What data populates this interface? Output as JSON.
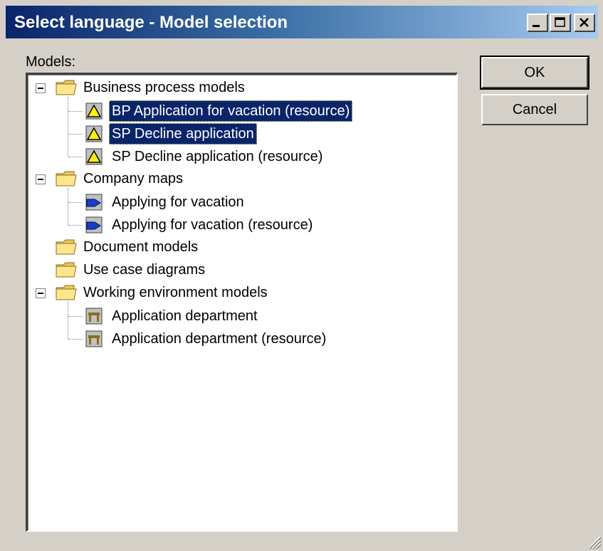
{
  "window": {
    "title": "Select language - Model selection"
  },
  "titlebar_buttons": [
    "minimize-icon",
    "maximize-icon",
    "close-icon"
  ],
  "models_label": "Models:",
  "buttons": {
    "ok": "OK",
    "cancel": "Cancel"
  },
  "tree": {
    "groups": [
      {
        "label": "Business process models",
        "expanded": true,
        "items": [
          {
            "label": "BP Application for vacation (resource)",
            "icon": "process-model-icon",
            "selected": true
          },
          {
            "label": "SP Decline application",
            "icon": "process-model-icon",
            "selected": true
          },
          {
            "label": "SP Decline application (resource)",
            "icon": "process-model-icon",
            "selected": false
          }
        ]
      },
      {
        "label": "Company maps",
        "expanded": true,
        "items": [
          {
            "label": "Applying for vacation",
            "icon": "company-map-icon",
            "selected": false
          },
          {
            "label": "Applying for vacation (resource)",
            "icon": "company-map-icon",
            "selected": false
          }
        ]
      },
      {
        "label": "Document models",
        "expanded": false,
        "items": []
      },
      {
        "label": "Use case diagrams",
        "expanded": false,
        "items": []
      },
      {
        "label": "Working environment models",
        "expanded": true,
        "items": [
          {
            "label": "Application department",
            "icon": "environment-model-icon",
            "selected": false
          },
          {
            "label": "Application department (resource)",
            "icon": "environment-model-icon",
            "selected": false
          }
        ]
      }
    ]
  },
  "colors": {
    "selection": "#0a246a",
    "titlebar_start": "#0a246a",
    "titlebar_end": "#a6caf0",
    "face": "#d4d0c8"
  }
}
